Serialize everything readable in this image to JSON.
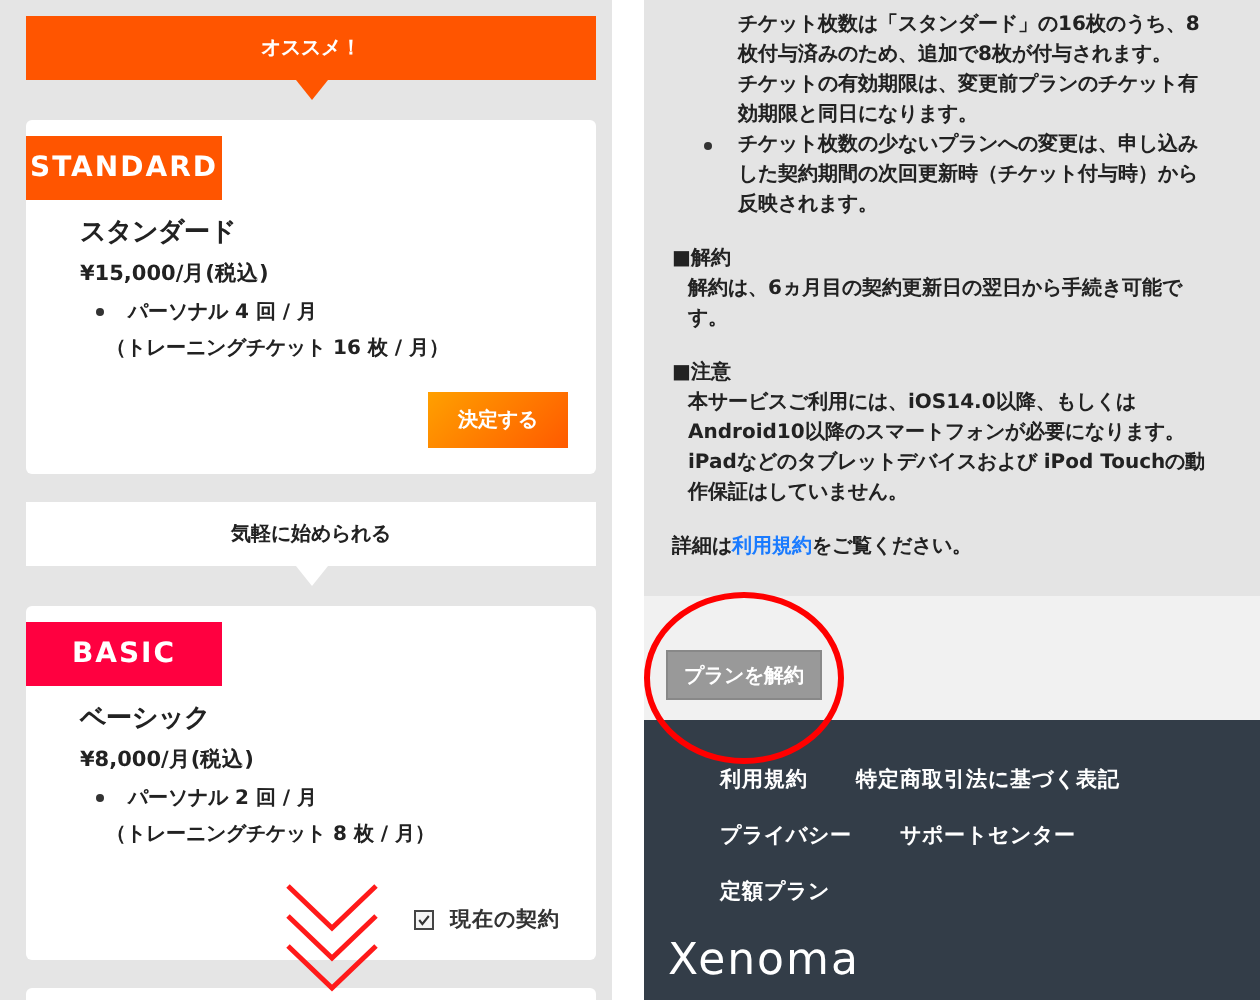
{
  "plans": [
    {
      "banner": {
        "text": "オススメ！",
        "kind": "recommended"
      },
      "badge": {
        "text": "STANDARD",
        "color": "#ff5500"
      },
      "name": "スタンダード",
      "price": "¥15,000/月(税込)",
      "feature": "パーソナル 4 回 / 月",
      "detail": "（トレーニングチケット 16 枚 / 月）",
      "action": "決定する"
    },
    {
      "banner": {
        "text": "気軽に始められる",
        "kind": "plain"
      },
      "badge": {
        "text": "BASIC",
        "color": "#ff0040"
      },
      "name": "ベーシック",
      "price": "¥8,000/月(税込)",
      "feature": "パーソナル 2 回 / 月",
      "detail": "（トレーニングチケット 8 枚 / 月）",
      "current_label": "現在の契約",
      "current": true
    }
  ],
  "notes": [
    {
      "kind": "continuation",
      "lines": [
        "チケット枚数は「スタンダード」の16枚のうち、8",
        "枚付与済みのため、追加で8枚が付与されます。",
        "チケットの有効期限は、変更前プランのチケット有",
        "効期限と同日になります。"
      ]
    },
    {
      "kind": "bullet",
      "lines": [
        "チケット枚数の少ないプランへの変更は、申し込み",
        "した契約期間の次回更新時（チケット付与時）から",
        "反映されます。"
      ]
    }
  ],
  "sections": [
    {
      "heading": "■解約",
      "lines": [
        "解約は、6ヵ月目の契約更新日の翌日から手続き可能で",
        "す。"
      ]
    },
    {
      "heading": "■注意",
      "lines": [
        "本サービスご利用には、iOS14.0以降、もしくは",
        "Android10以降のスマートフォンが必要になります。",
        "iPadなどのタブレットデバイスおよび iPod Touchの動",
        "作保証はしていません。"
      ]
    }
  ],
  "details": {
    "before": "詳細は",
    "link": "利用規約",
    "after": "をご覧ください。"
  },
  "cancel_button": "プランを解約",
  "footer": {
    "links": [
      [
        "利用規約",
        "特定商取引法に基づく表記"
      ],
      [
        "プライバシー",
        "サポートセンター"
      ],
      [
        "定額プラン"
      ]
    ],
    "logo": "Xenoma"
  }
}
